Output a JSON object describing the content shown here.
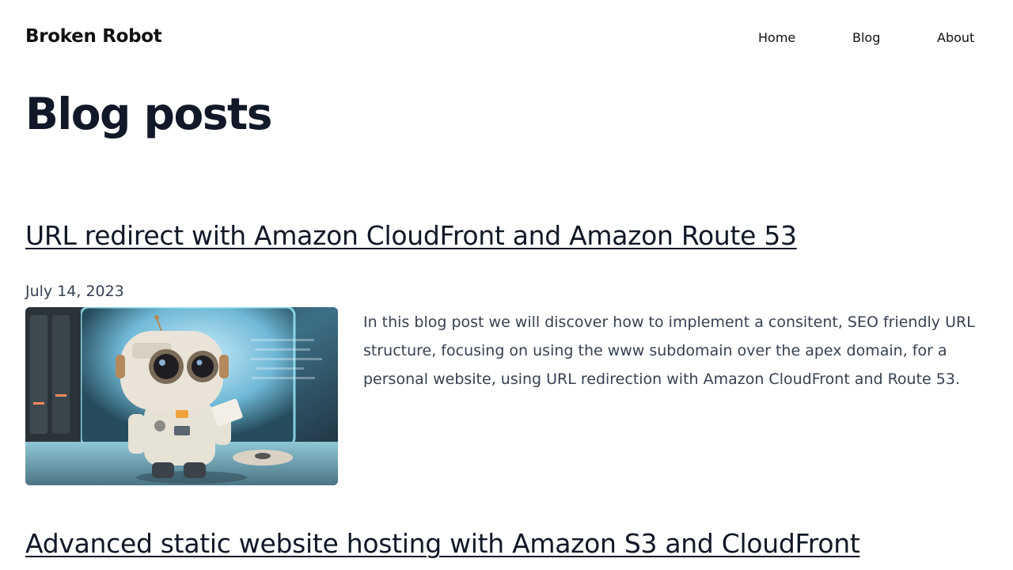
{
  "header": {
    "site_title": "Broken Robot",
    "nav": [
      "Home",
      "Blog",
      "About"
    ]
  },
  "main": {
    "page_title": "Blog posts",
    "posts": [
      {
        "title": "URL redirect with Amazon CloudFront and Amazon Route 53",
        "date": "July 14, 2023",
        "excerpt": "In this blog post we will discover how to implement a consitent, SEO friendly URL structure, focusing on using the www subdomain over the apex domain, for a personal website, using URL redirection with Amazon CloudFront and Route 53."
      },
      {
        "title": "Advanced static website hosting with Amazon S3 and CloudFront"
      }
    ]
  },
  "colors": {
    "text": "#111827",
    "muted": "#374151",
    "background": "#ffffff"
  }
}
